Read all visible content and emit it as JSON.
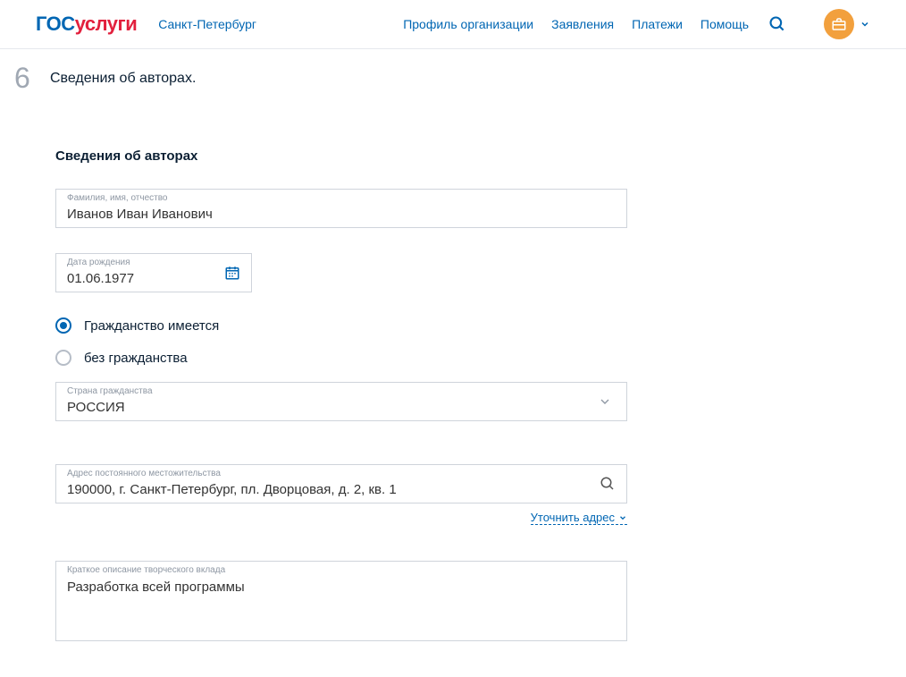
{
  "header": {
    "logo_gos": "гос",
    "logo_uslugi": "услуги",
    "city": "Санкт-Петербург",
    "nav": {
      "profile_org": "Профиль организации",
      "applications": "Заявления",
      "payments": "Платежи",
      "help": "Помощь"
    }
  },
  "step": {
    "number": "6",
    "title": "Сведения об авторах."
  },
  "section_heading": "Сведения об авторах",
  "fields": {
    "fullname": {
      "label": "Фамилия, имя, отчество",
      "value": "Иванов Иван Иванович"
    },
    "birthdate": {
      "label": "Дата рождения",
      "value": "01.06.1977"
    },
    "radio_has": "Гражданство имеется",
    "radio_none": "без гражданства",
    "country": {
      "label": "Страна гражданства",
      "value": "РОССИЯ"
    },
    "address": {
      "label": "Адрес постоянного местожительства",
      "value": "190000, г. Санкт-Петербург, пл. Дворцовая, д. 2, кв. 1"
    },
    "refine_address": "Уточнить адрес",
    "contribution": {
      "label": "Краткое описание творческого вклада",
      "value": "Разработка всей программы"
    }
  }
}
